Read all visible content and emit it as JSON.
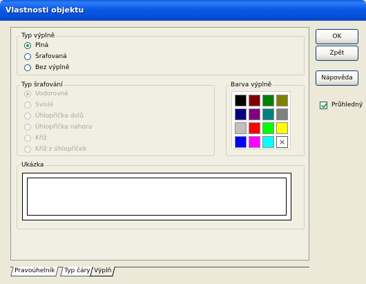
{
  "window": {
    "title": "Vlastnosti objektu"
  },
  "fill_type": {
    "legend": "Typ výplně",
    "options": [
      {
        "label": "Plná",
        "checked": true
      },
      {
        "label": "Šrafovaná",
        "checked": false
      },
      {
        "label": "Bez výplně",
        "checked": false
      }
    ]
  },
  "hatch_type": {
    "legend": "Typ šrafování",
    "options": [
      {
        "label": "Vodorovné",
        "checked": true
      },
      {
        "label": "Svislé",
        "checked": false
      },
      {
        "label": "Úhlopříčka dolů",
        "checked": false
      },
      {
        "label": "Úhlopříčka nahoru",
        "checked": false
      },
      {
        "label": "Kříž",
        "checked": false
      },
      {
        "label": "Kříž z úhlopříček",
        "checked": false
      }
    ]
  },
  "fill_color": {
    "legend": "Barva výplně",
    "colors": [
      "#000000",
      "#800000",
      "#008000",
      "#808000",
      "#000080",
      "#800080",
      "#008080",
      "#808080",
      "#c0c0c0",
      "#ff0000",
      "#00ff00",
      "#ffff00",
      "#0000ff",
      "#ff00ff",
      "#00ffff",
      "none"
    ],
    "none_symbol": "×"
  },
  "preview": {
    "legend": "Ukázka"
  },
  "tabs": [
    {
      "label": "Pravoúhelník"
    },
    {
      "label": "Typ čáry"
    },
    {
      "label": "Výplň",
      "active": true
    }
  ],
  "buttons": {
    "ok": "OK",
    "back": "Zpět",
    "help": "Nápověda"
  },
  "transparent": {
    "label": "Průhledný",
    "checked": true
  }
}
